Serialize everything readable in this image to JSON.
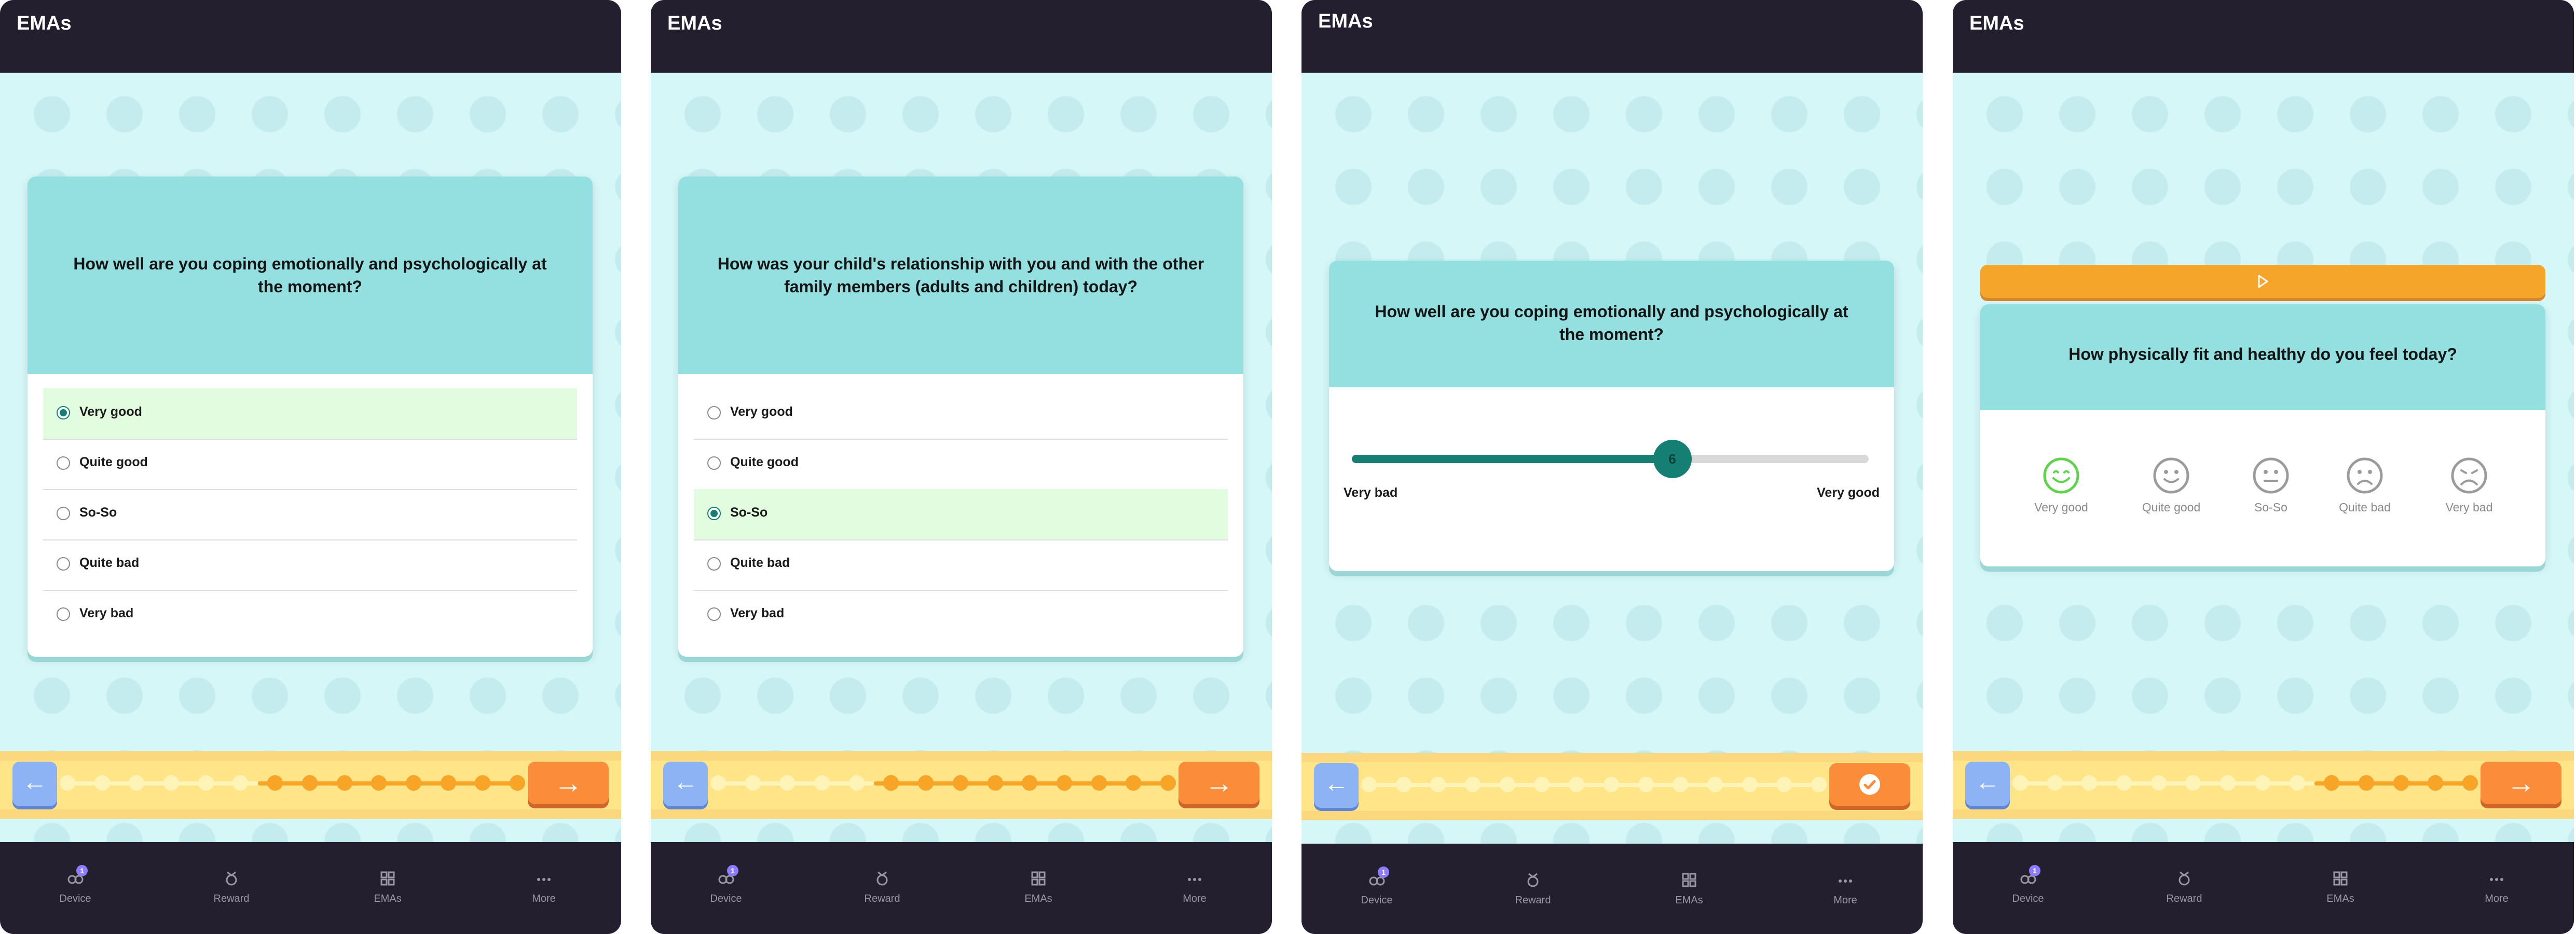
{
  "screens": [
    {
      "app_title": "EMAs",
      "question": "How well are you coping emotionally and psychologically at the moment?",
      "options": [
        {
          "label": "Very good",
          "selected": true
        },
        {
          "label": "Quite good",
          "selected": false
        },
        {
          "label": "So-So",
          "selected": false
        },
        {
          "label": "Quite bad",
          "selected": false
        },
        {
          "label": "Very bad",
          "selected": false
        }
      ],
      "progress": {
        "total_steps": 14,
        "completed_steps": 8
      }
    },
    {
      "app_title": "EMAs",
      "question": "How was your child's relationship with you and with the other family members (adults and children) today?",
      "options": [
        {
          "label": "Very good",
          "selected": false
        },
        {
          "label": "Quite good",
          "selected": false
        },
        {
          "label": "So-So",
          "selected": true
        },
        {
          "label": "Quite bad",
          "selected": false
        },
        {
          "label": "Very bad",
          "selected": false
        }
      ],
      "progress": {
        "total_steps": 14,
        "completed_steps": 9
      }
    },
    {
      "app_title": "EMAs",
      "question": "How well are you coping emotionally and psychologically at the moment?",
      "slider": {
        "value": "6",
        "fraction": 0.62,
        "min_label": "Very bad",
        "max_label": "Very good"
      },
      "progress": {
        "total_steps": 14,
        "completed_steps": 14
      },
      "next_icon": "check-icon"
    },
    {
      "app_title": "EMAs",
      "question": "How physically fit and healthy do you feel today?",
      "faces": [
        {
          "label": "Very good",
          "icon": "very-happy-face-icon",
          "selected": true
        },
        {
          "label": "Quite good",
          "icon": "happy-face-icon",
          "selected": false
        },
        {
          "label": "So-So",
          "icon": "neutral-face-icon",
          "selected": false
        },
        {
          "label": "Quite bad",
          "icon": "sad-face-icon",
          "selected": false
        },
        {
          "label": "Very bad",
          "icon": "very-sad-face-icon",
          "selected": false
        }
      ],
      "progress": {
        "total_steps": 14,
        "completed_steps": 5
      }
    }
  ],
  "nav": {
    "items": [
      {
        "label": "Device",
        "icon": "device-icon",
        "badge": "1"
      },
      {
        "label": "Reward",
        "icon": "reward-icon"
      },
      {
        "label": "EMAs",
        "icon": "grid-icon"
      },
      {
        "label": "More",
        "icon": "more-icon"
      }
    ]
  },
  "colors": {
    "teal_dark": "#157f73",
    "selected_bg": "#e2fce0",
    "orange": "#fb8c3a",
    "done_dot": "#f7a427",
    "todo_dot": "#fff4b8",
    "smile_green": "#5dd44a"
  }
}
